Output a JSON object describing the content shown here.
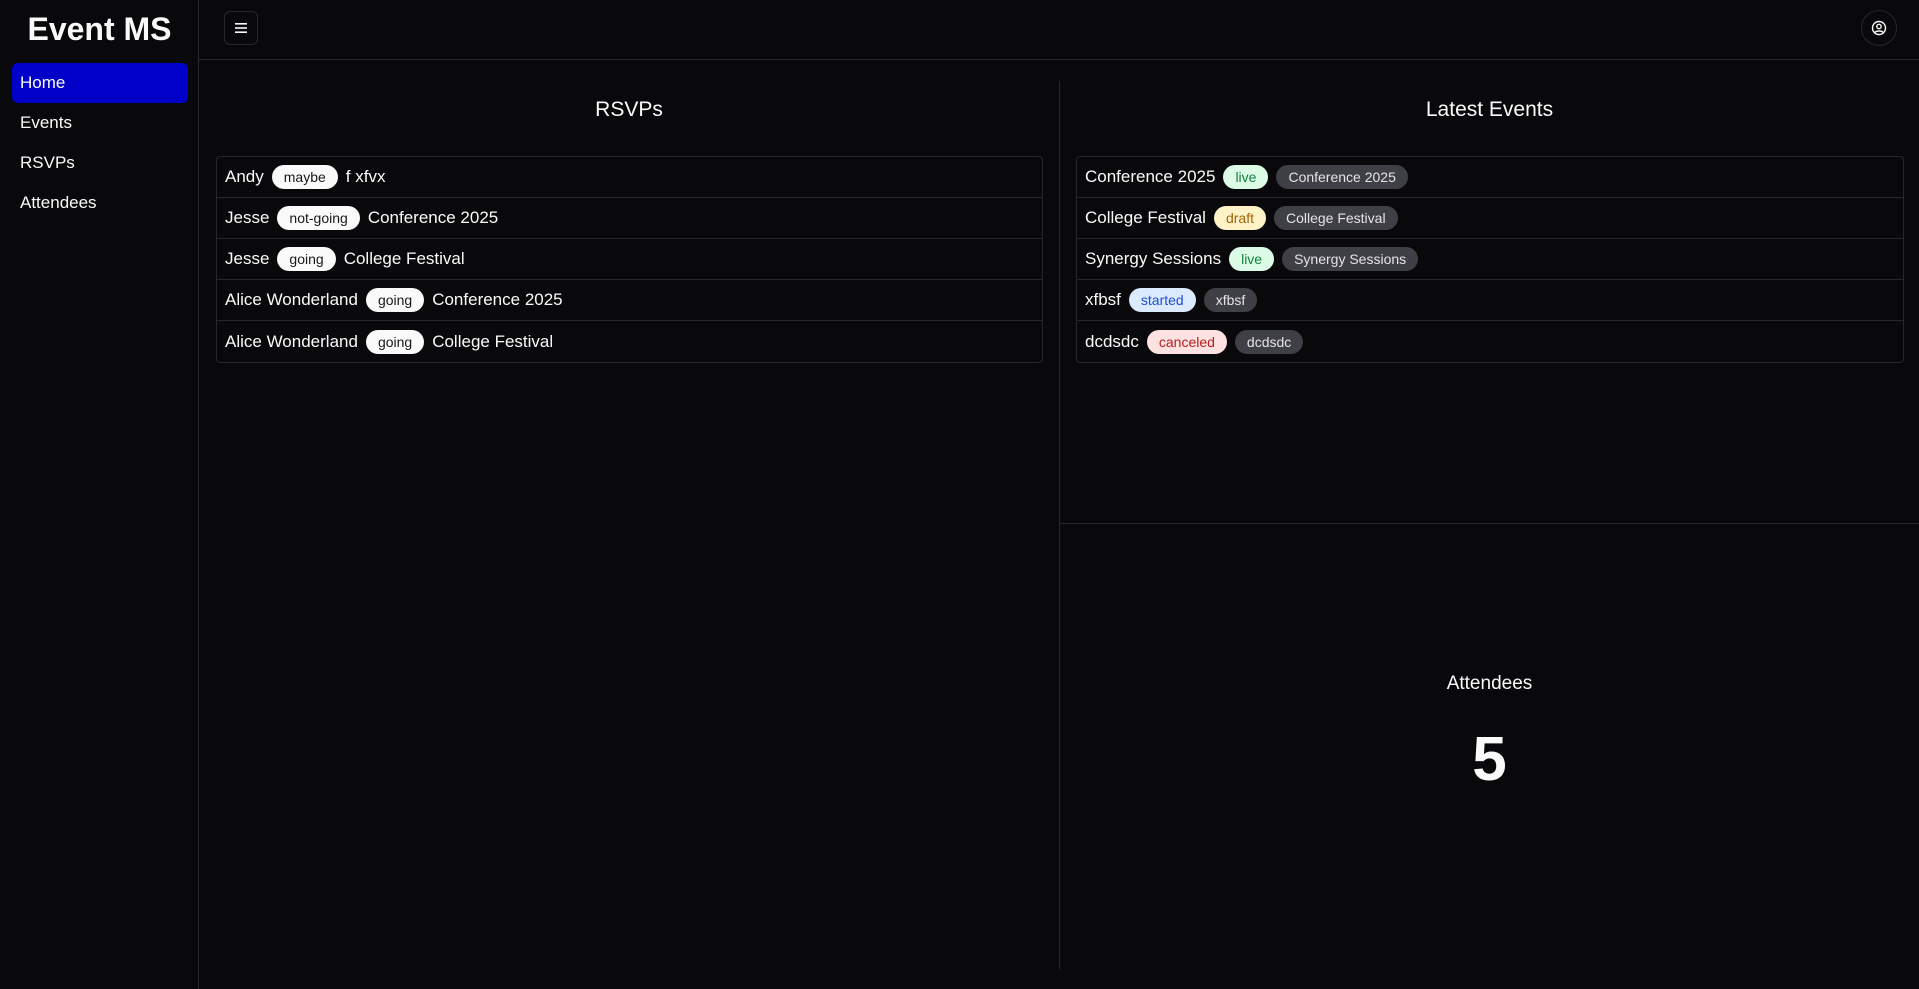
{
  "app": {
    "title": "Event MS"
  },
  "sidebar": {
    "items": [
      {
        "label": "Home",
        "active": true
      },
      {
        "label": "Events",
        "active": false
      },
      {
        "label": "RSVPs",
        "active": false
      },
      {
        "label": "Attendees",
        "active": false
      }
    ]
  },
  "topbar": {
    "menu_icon": "hamburger-icon",
    "user_icon": "user-circle-icon"
  },
  "rsvps": {
    "title": "RSVPs",
    "rows": [
      {
        "name": "Andy",
        "status": "maybe",
        "event": "f xfvx"
      },
      {
        "name": "Jesse",
        "status": "not-going",
        "event": "Conference 2025"
      },
      {
        "name": "Jesse",
        "status": "going",
        "event": "College Festival"
      },
      {
        "name": "Alice Wonderland",
        "status": "going",
        "event": "Conference 2025"
      },
      {
        "name": "Alice Wonderland",
        "status": "going",
        "event": "College Festival"
      }
    ]
  },
  "latest_events": {
    "title": "Latest Events",
    "rows": [
      {
        "name": "Conference 2025",
        "status": "live",
        "tag": "Conference 2025"
      },
      {
        "name": "College Festival",
        "status": "draft",
        "tag": "College Festival"
      },
      {
        "name": "Synergy Sessions",
        "status": "live",
        "tag": "Synergy Sessions"
      },
      {
        "name": "xfbsf",
        "status": "started",
        "tag": "xfbsf"
      },
      {
        "name": "dcdsdc",
        "status": "canceled",
        "tag": "dcdsdc"
      }
    ]
  },
  "attendees": {
    "label": "Attendees",
    "count": "5"
  },
  "colors": {
    "accent": "#0000c8",
    "live": "#dcfce7",
    "draft": "#fef3c7",
    "started": "#dbeafe",
    "canceled": "#fee2e2"
  }
}
